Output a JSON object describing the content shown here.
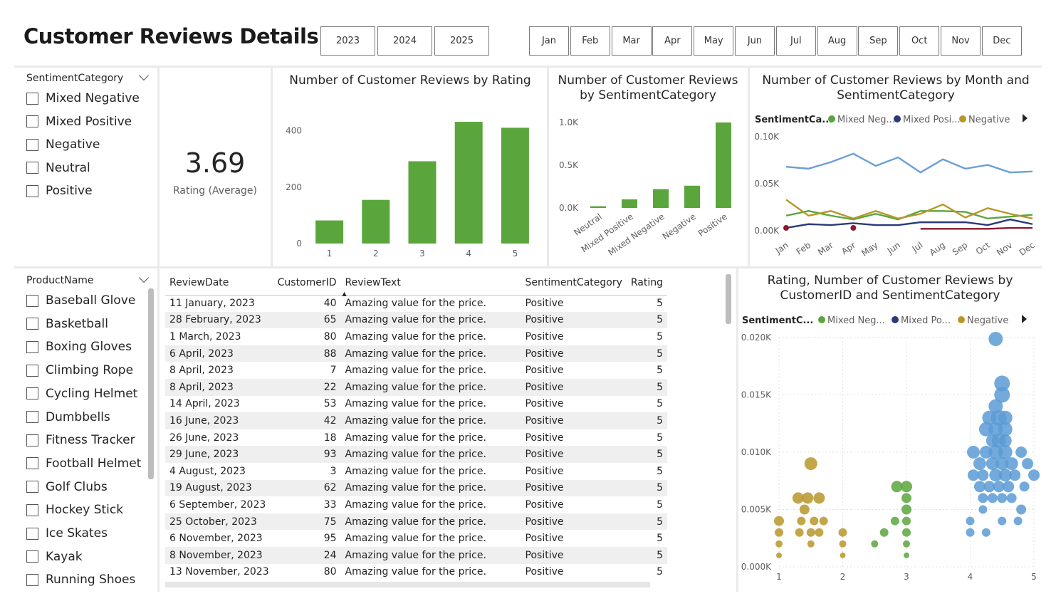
{
  "title": "Customer Reviews Details",
  "years": [
    "2023",
    "2024",
    "2025"
  ],
  "months": [
    "Jan",
    "Feb",
    "Mar",
    "Apr",
    "May",
    "Jun",
    "Jul",
    "Aug",
    "Sep",
    "Oct",
    "Nov",
    "Dec"
  ],
  "sentiment_slicer": {
    "title": "SentimentCategory",
    "items": [
      "Mixed Negative",
      "Mixed Positive",
      "Negative",
      "Neutral",
      "Positive"
    ]
  },
  "product_slicer": {
    "title": "ProductName",
    "items": [
      "Baseball Glove",
      "Basketball",
      "Boxing Gloves",
      "Climbing Rope",
      "Cycling Helmet",
      "Dumbbells",
      "Fitness Tracker",
      "Football Helmet",
      "Golf Clubs",
      "Hockey Stick",
      "Ice Skates",
      "Kayak",
      "Running Shoes"
    ]
  },
  "card": {
    "value": "3.69",
    "label": "Rating (Average)"
  },
  "table": {
    "columns": [
      "ReviewDate",
      "CustomerID",
      "ReviewText",
      "SentimentCategory",
      "Rating"
    ],
    "rows": [
      [
        "11 January, 2023",
        "40",
        "Amazing value for the price.",
        "Positive",
        "5"
      ],
      [
        "28 February, 2023",
        "65",
        "Amazing value for the price.",
        "Positive",
        "5"
      ],
      [
        "1 March, 2023",
        "80",
        "Amazing value for the price.",
        "Positive",
        "5"
      ],
      [
        "6 April, 2023",
        "88",
        "Amazing value for the price.",
        "Positive",
        "5"
      ],
      [
        "8 April, 2023",
        "7",
        "Amazing value for the price.",
        "Positive",
        "5"
      ],
      [
        "8 April, 2023",
        "22",
        "Amazing value for the price.",
        "Positive",
        "5"
      ],
      [
        "14 April, 2023",
        "53",
        "Amazing value for the price.",
        "Positive",
        "5"
      ],
      [
        "16 June, 2023",
        "42",
        "Amazing value for the price.",
        "Positive",
        "5"
      ],
      [
        "26 June, 2023",
        "18",
        "Amazing value for the price.",
        "Positive",
        "5"
      ],
      [
        "29 June, 2023",
        "93",
        "Amazing value for the price.",
        "Positive",
        "5"
      ],
      [
        "4 August, 2023",
        "3",
        "Amazing value for the price.",
        "Positive",
        "5"
      ],
      [
        "19 August, 2023",
        "62",
        "Amazing value for the price.",
        "Positive",
        "5"
      ],
      [
        "6 September, 2023",
        "33",
        "Amazing value for the price.",
        "Positive",
        "5"
      ],
      [
        "25 October, 2023",
        "75",
        "Amazing value for the price.",
        "Positive",
        "5"
      ],
      [
        "6 November, 2023",
        "95",
        "Amazing value for the price.",
        "Positive",
        "5"
      ],
      [
        "8 November, 2023",
        "24",
        "Amazing value for the price.",
        "Positive",
        "5"
      ],
      [
        "13 November, 2023",
        "80",
        "Amazing value for the price.",
        "Positive",
        "5"
      ]
    ]
  },
  "colors": {
    "green": "#5aa63c",
    "blue": "#6a9fd8",
    "navy": "#2b3a78",
    "gold": "#b8962a",
    "maroon": "#8b1a2b",
    "scatter_blue": "#5b9bd5",
    "scatter_green": "#5aa63c",
    "scatter_gold": "#b8962a"
  },
  "chart_data": [
    {
      "id": "by_rating",
      "type": "bar",
      "title": "Number of Customer Reviews by Rating",
      "categories": [
        "1",
        "2",
        "3",
        "4",
        "5"
      ],
      "values": [
        82,
        155,
        292,
        432,
        411
      ],
      "yticks": [
        "0",
        "200",
        "400"
      ],
      "ylim": [
        0,
        460
      ]
    },
    {
      "id": "by_sentiment",
      "type": "bar",
      "title": "Number of Customer Reviews by SentimentCategory",
      "categories": [
        "Neutral",
        "Mixed Positive",
        "Mixed Negative",
        "Negative",
        "Positive"
      ],
      "values": [
        20,
        100,
        220,
        260,
        1000
      ],
      "yticks": [
        "0.0K",
        "0.5K",
        "1.0K"
      ],
      "ylim": [
        0,
        1100
      ]
    },
    {
      "id": "by_month",
      "type": "line",
      "title": "Number of Customer Reviews by Month and SentimentCategory",
      "legend_title": "SentimentCa...",
      "legend": [
        "Mixed Neg...",
        "Mixed Posi...",
        "Negative"
      ],
      "categories": [
        "Jan",
        "Feb",
        "Mar",
        "Apr",
        "May",
        "Jun",
        "Jul",
        "Aug",
        "Sep",
        "Oct",
        "Nov",
        "Dec"
      ],
      "yticks": [
        "0.00K",
        "0.05K",
        "0.10K"
      ],
      "ylim": [
        0,
        0.1
      ],
      "series": [
        {
          "values": [
            0.068,
            0.066,
            0.073,
            0.082,
            0.069,
            0.078,
            0.062,
            0.076,
            0.066,
            0.07,
            0.062,
            0.063
          ]
        },
        {
          "values": [
            0.016,
            0.021,
            0.016,
            0.012,
            0.018,
            0.012,
            0.021,
            0.021,
            0.02,
            0.013,
            0.015,
            0.017
          ]
        },
        {
          "values": [
            0.033,
            0.016,
            0.021,
            0.013,
            0.021,
            0.013,
            0.018,
            0.028,
            0.014,
            0.024,
            0.018,
            0.013
          ]
        },
        {
          "values": [
            0.003,
            0.007,
            0.006,
            0.008,
            0.006,
            0.006,
            0.009,
            0.009,
            0.009,
            0.006,
            0.012,
            0.007
          ]
        },
        {
          "values": [
            0.003,
            null,
            null,
            0.003,
            null,
            null,
            0.002,
            0.002,
            0.002,
            0.002,
            0.003,
            0.003
          ]
        }
      ]
    },
    {
      "id": "scatter",
      "type": "scatter",
      "title": "Rating, Number of Customer Reviews by CustomerID and SentimentCategory",
      "legend_title": "SentimentC...",
      "legend": [
        "Mixed Neg...",
        "Mixed Po...",
        "Negative"
      ],
      "xticks": [
        "1",
        "2",
        "3",
        "4",
        "5"
      ],
      "yticks": [
        "0.000K",
        "0.005K",
        "0.010K",
        "0.015K",
        "0.020K"
      ],
      "xlim": [
        1,
        5
      ],
      "ylim": [
        0,
        0.02
      ],
      "points": [
        {
          "g": "gold",
          "x": 1.5,
          "y": 0.009,
          "r": 9
        },
        {
          "g": "gold",
          "x": 1.3,
          "y": 0.006,
          "r": 8
        },
        {
          "g": "gold",
          "x": 1.45,
          "y": 0.006,
          "r": 8
        },
        {
          "g": "gold",
          "x": 1.63,
          "y": 0.006,
          "r": 8
        },
        {
          "g": "gold",
          "x": 1.4,
          "y": 0.005,
          "r": 7
        },
        {
          "g": "gold",
          "x": 1.0,
          "y": 0.004,
          "r": 7
        },
        {
          "g": "gold",
          "x": 1.35,
          "y": 0.004,
          "r": 6
        },
        {
          "g": "gold",
          "x": 1.55,
          "y": 0.004,
          "r": 6
        },
        {
          "g": "gold",
          "x": 1.7,
          "y": 0.004,
          "r": 6
        },
        {
          "g": "gold",
          "x": 1.0,
          "y": 0.003,
          "r": 6
        },
        {
          "g": "gold",
          "x": 1.32,
          "y": 0.003,
          "r": 6
        },
        {
          "g": "gold",
          "x": 1.5,
          "y": 0.003,
          "r": 6
        },
        {
          "g": "gold",
          "x": 1.63,
          "y": 0.003,
          "r": 6
        },
        {
          "g": "gold",
          "x": 2.0,
          "y": 0.003,
          "r": 6
        },
        {
          "g": "gold",
          "x": 1.0,
          "y": 0.002,
          "r": 5
        },
        {
          "g": "gold",
          "x": 1.5,
          "y": 0.002,
          "r": 5
        },
        {
          "g": "gold",
          "x": 2.0,
          "y": 0.002,
          "r": 5
        },
        {
          "g": "gold",
          "x": 1.0,
          "y": 0.001,
          "r": 4
        },
        {
          "g": "gold",
          "x": 2.0,
          "y": 0.001,
          "r": 4
        },
        {
          "g": "green",
          "x": 2.85,
          "y": 0.007,
          "r": 8
        },
        {
          "g": "green",
          "x": 3.0,
          "y": 0.007,
          "r": 8
        },
        {
          "g": "green",
          "x": 3.0,
          "y": 0.006,
          "r": 7
        },
        {
          "g": "green",
          "x": 3.0,
          "y": 0.005,
          "r": 7
        },
        {
          "g": "green",
          "x": 2.82,
          "y": 0.004,
          "r": 6
        },
        {
          "g": "green",
          "x": 3.0,
          "y": 0.004,
          "r": 6
        },
        {
          "g": "green",
          "x": 2.65,
          "y": 0.003,
          "r": 6
        },
        {
          "g": "green",
          "x": 3.0,
          "y": 0.003,
          "r": 6
        },
        {
          "g": "green",
          "x": 2.5,
          "y": 0.002,
          "r": 5
        },
        {
          "g": "green",
          "x": 3.0,
          "y": 0.002,
          "r": 5
        },
        {
          "g": "green",
          "x": 3.0,
          "y": 0.001,
          "r": 4
        },
        {
          "g": "blue",
          "x": 4.4,
          "y": 0.02,
          "r": 10
        },
        {
          "g": "blue",
          "x": 4.5,
          "y": 0.016,
          "r": 11
        },
        {
          "g": "blue",
          "x": 4.5,
          "y": 0.015,
          "r": 11
        },
        {
          "g": "blue",
          "x": 4.4,
          "y": 0.014,
          "r": 10
        },
        {
          "g": "blue",
          "x": 4.3,
          "y": 0.013,
          "r": 10
        },
        {
          "g": "blue",
          "x": 4.45,
          "y": 0.013,
          "r": 11
        },
        {
          "g": "blue",
          "x": 4.55,
          "y": 0.013,
          "r": 10
        },
        {
          "g": "blue",
          "x": 4.25,
          "y": 0.012,
          "r": 10
        },
        {
          "g": "blue",
          "x": 4.4,
          "y": 0.012,
          "r": 10
        },
        {
          "g": "blue",
          "x": 4.55,
          "y": 0.012,
          "r": 10
        },
        {
          "g": "blue",
          "x": 4.45,
          "y": 0.011,
          "r": 10
        },
        {
          "g": "blue",
          "x": 4.55,
          "y": 0.011,
          "r": 9
        },
        {
          "g": "blue",
          "x": 4.35,
          "y": 0.011,
          "r": 9
        },
        {
          "g": "blue",
          "x": 4.05,
          "y": 0.01,
          "r": 9
        },
        {
          "g": "blue",
          "x": 4.25,
          "y": 0.01,
          "r": 9
        },
        {
          "g": "blue",
          "x": 4.4,
          "y": 0.01,
          "r": 10
        },
        {
          "g": "blue",
          "x": 4.55,
          "y": 0.01,
          "r": 10
        },
        {
          "g": "blue",
          "x": 4.8,
          "y": 0.01,
          "r": 8
        },
        {
          "g": "blue",
          "x": 4.15,
          "y": 0.009,
          "r": 9
        },
        {
          "g": "blue",
          "x": 4.35,
          "y": 0.009,
          "r": 9
        },
        {
          "g": "blue",
          "x": 4.5,
          "y": 0.009,
          "r": 9
        },
        {
          "g": "blue",
          "x": 4.65,
          "y": 0.009,
          "r": 9
        },
        {
          "g": "blue",
          "x": 4.9,
          "y": 0.009,
          "r": 8
        },
        {
          "g": "blue",
          "x": 4.05,
          "y": 0.008,
          "r": 8
        },
        {
          "g": "blue",
          "x": 4.2,
          "y": 0.008,
          "r": 8
        },
        {
          "g": "blue",
          "x": 4.4,
          "y": 0.008,
          "r": 9
        },
        {
          "g": "blue",
          "x": 4.55,
          "y": 0.008,
          "r": 9
        },
        {
          "g": "blue",
          "x": 4.7,
          "y": 0.008,
          "r": 8
        },
        {
          "g": "blue",
          "x": 5.0,
          "y": 0.008,
          "r": 8
        },
        {
          "g": "blue",
          "x": 4.15,
          "y": 0.007,
          "r": 8
        },
        {
          "g": "blue",
          "x": 4.3,
          "y": 0.007,
          "r": 8
        },
        {
          "g": "blue",
          "x": 4.45,
          "y": 0.007,
          "r": 8
        },
        {
          "g": "blue",
          "x": 4.6,
          "y": 0.007,
          "r": 8
        },
        {
          "g": "blue",
          "x": 4.85,
          "y": 0.007,
          "r": 7
        },
        {
          "g": "blue",
          "x": 4.2,
          "y": 0.006,
          "r": 7
        },
        {
          "g": "blue",
          "x": 4.35,
          "y": 0.006,
          "r": 7
        },
        {
          "g": "blue",
          "x": 4.5,
          "y": 0.006,
          "r": 7
        },
        {
          "g": "blue",
          "x": 4.65,
          "y": 0.006,
          "r": 7
        },
        {
          "g": "blue",
          "x": 4.2,
          "y": 0.005,
          "r": 6
        },
        {
          "g": "blue",
          "x": 4.8,
          "y": 0.005,
          "r": 7
        },
        {
          "g": "blue",
          "x": 4.0,
          "y": 0.004,
          "r": 6
        },
        {
          "g": "blue",
          "x": 4.5,
          "y": 0.004,
          "r": 6
        },
        {
          "g": "blue",
          "x": 4.75,
          "y": 0.004,
          "r": 6
        },
        {
          "g": "blue",
          "x": 4.0,
          "y": 0.003,
          "r": 6
        },
        {
          "g": "blue",
          "x": 4.25,
          "y": 0.003,
          "r": 6
        }
      ]
    }
  ]
}
